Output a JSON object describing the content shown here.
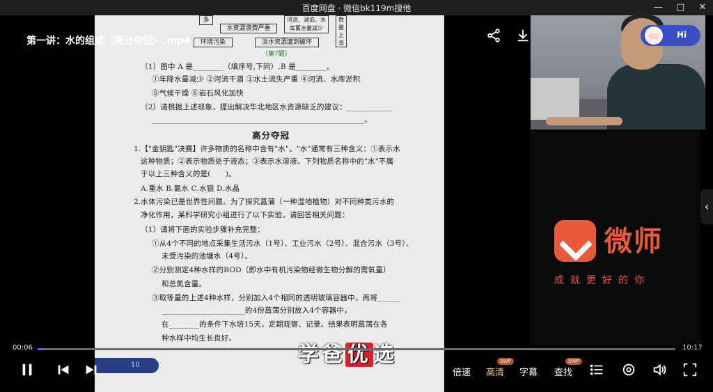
{
  "window": {
    "title": "百度网盘 · 微信bk119m搜他",
    "minimize_icon": "minimize-icon",
    "maximize_icon": "maximize-icon",
    "close_icon": "close-icon"
  },
  "video": {
    "title": "第一讲：水的组成（高分夺冠）.mp4",
    "current_time": "00:06",
    "total_time": "10:17",
    "progress_fraction": 0.0058
  },
  "top_actions": [
    "share-icon",
    "download-icon",
    "more-icon",
    "screenshot-icon",
    "pip-icon"
  ],
  "assistant_badge": {
    "label": "Hi"
  },
  "document": {
    "diagram": {
      "box_duo": "多",
      "box_waste": "水资源浪费严重",
      "box_pollution": "环境污染",
      "box_freshwater": "淡水资源遭到破坏",
      "box_river": "河流、湖泊、水库蓄水量减少",
      "box_rise": "数量上涨",
      "fig_label": "（第7题）"
    },
    "lines": [
      "（1）图中 A 是________（填序号,下同）,B 是________。",
      "①年降水量减少   ②河流干涸   ③水土流失严重   ④河流、水库淤积",
      "⑤气候干燥   ⑥岩石风化加快",
      "（2）请根据上述现象，提出解决华北地区水资源缺乏的建议：____________",
      "________________________________________________________。",
      "1.【\"金钥匙\"决赛】许多物质的名称中含有\"水\"。\"水\"通常有三种含义：①表示水",
      "这种物质；②表示物质处于液态；③表示水溶液。下列物质名称中的\"水\"不属",
      "于以上三种含义的是(　　)。",
      "A.重水          B.氨水          C.水银          D.水晶",
      "2.水体污染已是世界性问题。为了探究菖蒲（一种湿地植物）对不同种类污水的",
      "净化作用，某科学研究小组进行了以下实验，请回答相关问题：",
      "（1）请将下面的实验步骤补充完整：",
      "①从4个不同的地点采集生活污水（1号）、工业污水（2号）、混合污水（3号）、",
      "未受污染的池塘水（4号）。",
      "②分别测定4种水样的BOD（即水中有机污染物经微生物分解的需氧量）",
      "和总氮含量。",
      "③取等量的上述4种水样，分别加入4个相同的透明玻璃容器中，再将______",
      "______________________的4份菖蒲分别放入4个容器中，",
      "在________的条件下水培15天，定期观察、记录。结果表明菖蒲在各",
      "种水样中均生长良好。"
    ],
    "section_title": "高分夺冠",
    "page_number": "10"
  },
  "logo": {
    "name": "微师",
    "slogan": "成就更好的你"
  },
  "watermark": {
    "part1": "学爸",
    "highlight": "优",
    "part2": "选"
  },
  "controls": {
    "speed_label": "倍速",
    "quality_label": "高清",
    "subtitle_label": "字幕",
    "search_label": "查找",
    "swp_badge": "SWP"
  },
  "colors": {
    "accent": "#4a6cf7",
    "brand_orange": "#e85a3c",
    "active_text": "#f0d29a"
  }
}
